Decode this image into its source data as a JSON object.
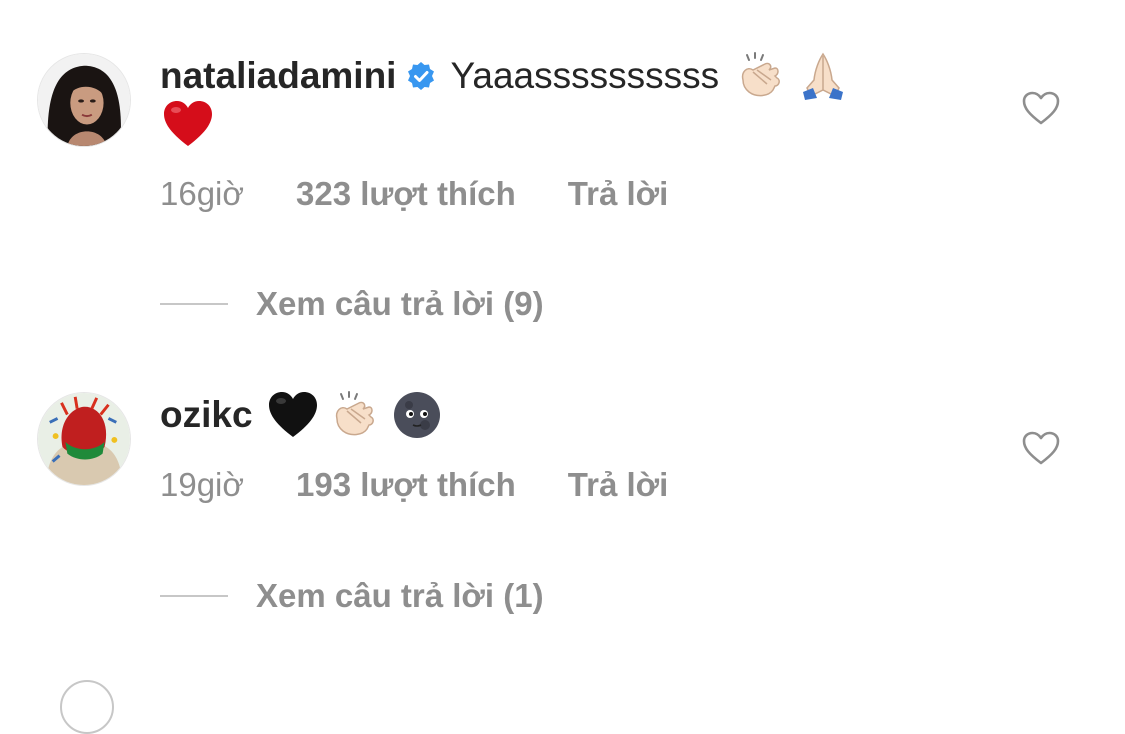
{
  "comments": [
    {
      "username": "nataliadamini",
      "verified": true,
      "text": "Yaaassssssssss",
      "emojis": [
        "clapping-hands-icon",
        "folded-hands-icon",
        "red-heart-icon"
      ],
      "time": "16giờ",
      "likes": "323 lượt thích",
      "reply": "Trả lời",
      "view_replies": "Xem câu trả lời (9)"
    },
    {
      "username": "ozikc",
      "verified": false,
      "text": "",
      "emojis": [
        "black-heart-icon",
        "clapping-hands-icon",
        "new-moon-face-icon"
      ],
      "time": "19giờ",
      "likes": "193 lượt thích",
      "reply": "Trả lời",
      "view_replies": "Xem câu trả lời (1)"
    }
  ],
  "colors": {
    "text": "#262626",
    "secondary": "#8e8e8e",
    "verified_blue": "#3897f0",
    "heart_red": "#d50d1a"
  }
}
